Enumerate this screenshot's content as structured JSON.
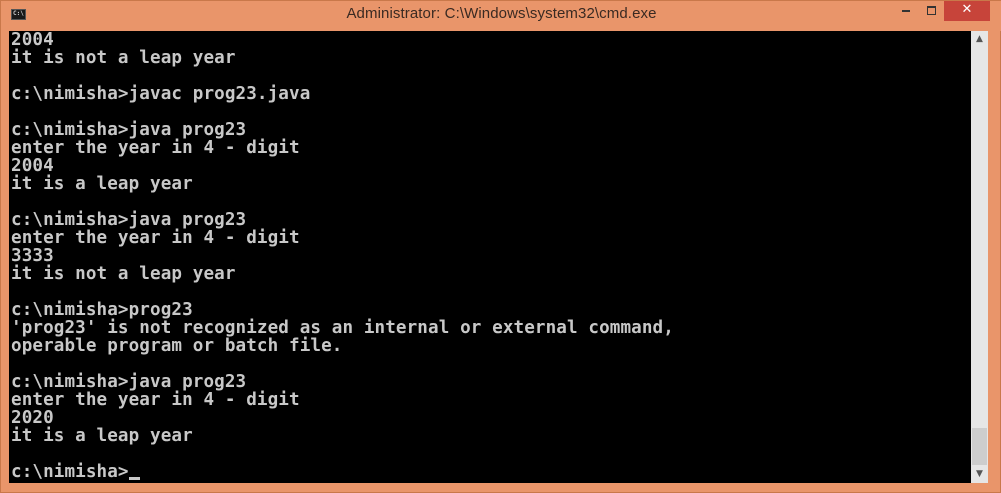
{
  "window": {
    "title": "Administrator: C:\\Windows\\system32\\cmd.exe",
    "icon_label": "C:\\",
    "icon": "cmd-icon",
    "buttons": {
      "minimize_icon": "minimize-icon",
      "maximize_icon": "maximize-icon",
      "close_label": "✕"
    }
  },
  "console": {
    "lines": [
      "2004",
      "it is not a leap year",
      "",
      "c:\\nimisha>javac prog23.java",
      "",
      "c:\\nimisha>java prog23",
      "enter the year in 4 - digit",
      "2004",
      "it is a leap year",
      "",
      "c:\\nimisha>java prog23",
      "enter the year in 4 - digit",
      "3333",
      "it is not a leap year",
      "",
      "c:\\nimisha>prog23",
      "'prog23' is not recognized as an internal or external command,",
      "operable program or batch file.",
      "",
      "c:\\nimisha>java prog23",
      "enter the year in 4 - digit",
      "2020",
      "it is a leap year",
      "",
      "c:\\nimisha>"
    ]
  },
  "scrollbar": {
    "up_arrow": "▲",
    "down_arrow": "▼"
  },
  "colors": {
    "titlebar": "#e9956a",
    "console_bg": "#000000",
    "console_text": "#c8c8c8",
    "close_button": "#c7443a"
  }
}
